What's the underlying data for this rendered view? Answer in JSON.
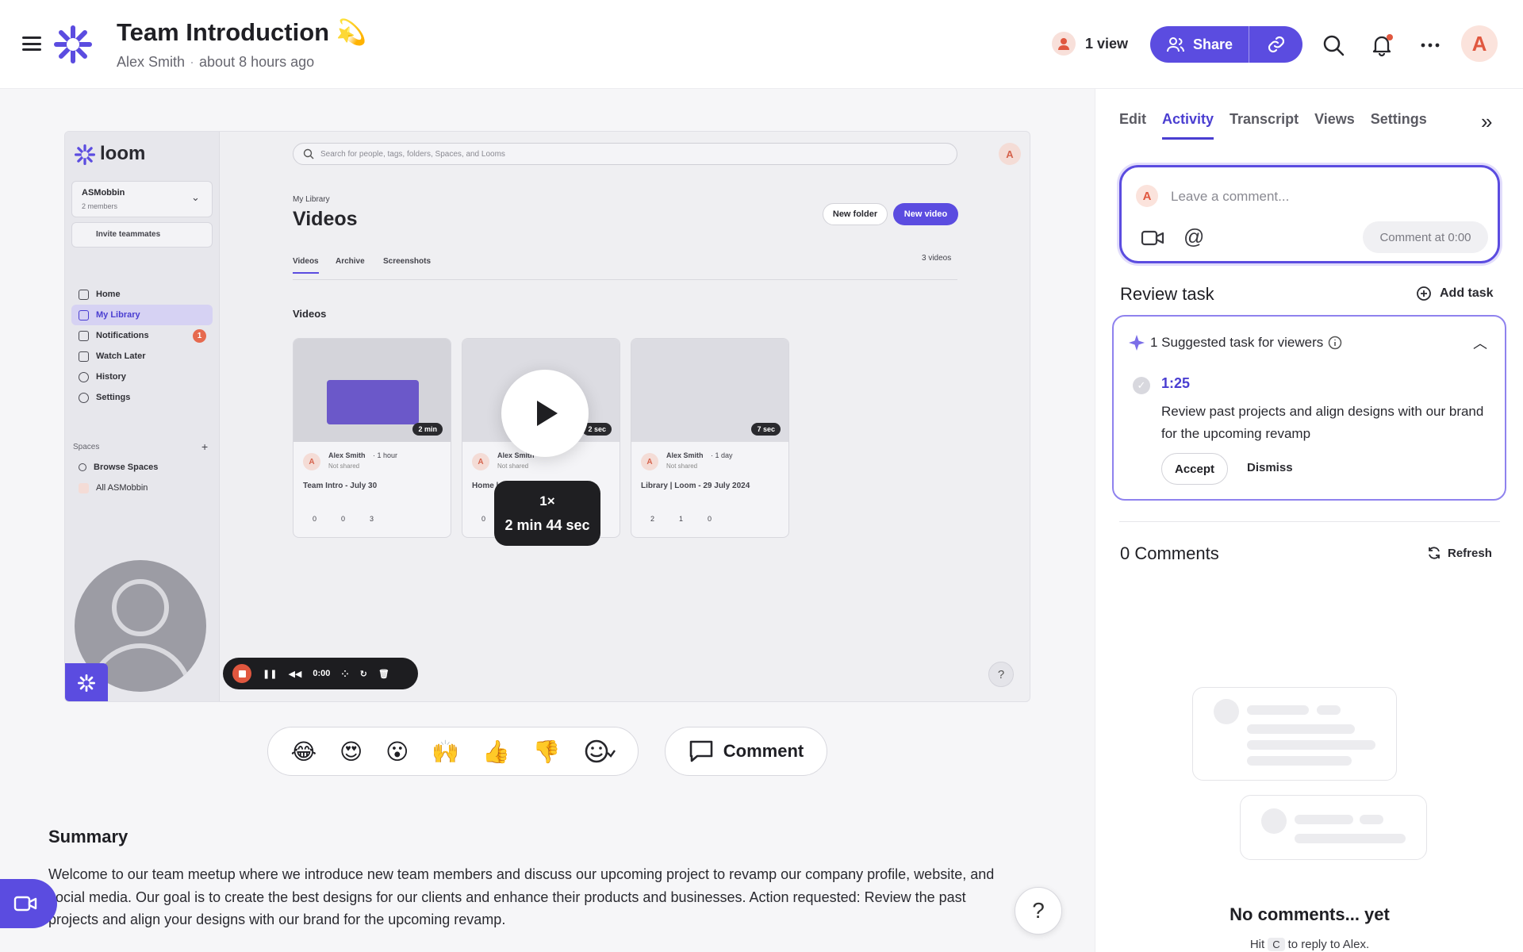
{
  "header": {
    "title": "Team Introduction 💫",
    "author": "Alex Smith",
    "time_ago": "about 8 hours ago",
    "views": "1 view",
    "share_label": "Share",
    "user_initial": "A"
  },
  "colors": {
    "accent": "#5b4ce0",
    "avatar_bg": "#fbe3dc",
    "avatar_fg": "#e0573f"
  },
  "video": {
    "sidebar": {
      "brand": "loom",
      "workspace": "ASMobbin",
      "workspace_members": "2 members",
      "invite": "Invite teammates",
      "nav": [
        {
          "label": "Home"
        },
        {
          "label": "My Library"
        },
        {
          "label": "Notifications",
          "badge": "1"
        },
        {
          "label": "Watch Later"
        },
        {
          "label": "History"
        },
        {
          "label": "Settings"
        }
      ],
      "spaces_label": "Spaces",
      "browse_spaces": "Browse Spaces",
      "all_spaces": "All ASMobbin"
    },
    "search_placeholder": "Search for people, tags, folders, Spaces, and Looms",
    "avatar_initial": "A",
    "breadcrumb": "My Library",
    "page_title": "Videos",
    "new_folder": "New folder",
    "new_video": "New video",
    "tabs": [
      "Videos",
      "Archive",
      "Screenshots"
    ],
    "count": "3 videos",
    "section": "Videos",
    "cards": [
      {
        "author": "Alex Smith",
        "time": "· 1 hour",
        "sharing": "Not shared",
        "title": "Team Intro - July 30",
        "duration": "2 min",
        "stats": [
          "0",
          "0",
          "3"
        ]
      },
      {
        "author": "Alex Smith",
        "time": "",
        "sharing": "Not shared",
        "title": "Home |",
        "duration": "2 sec",
        "stats": [
          "0"
        ]
      },
      {
        "author": "Alex Smith",
        "time": "· 1 day",
        "sharing": "Not shared",
        "title": "Library | Loom - 29 July 2024",
        "duration": "7 sec",
        "stats": [
          "2",
          "1",
          "0"
        ]
      }
    ],
    "speed": "1×",
    "length": "2 min 44 sec",
    "rec_time": "0:00",
    "help": "?"
  },
  "reactions": [
    "😂",
    "😍",
    "😮",
    "🙌",
    "👍",
    "👎"
  ],
  "comment_button": "Comment",
  "summary": {
    "heading": "Summary",
    "text": "Welcome to our team meetup where we introduce new team members and discuss our upcoming project to revamp our company profile, website, and social media. Our goal is to create the best designs for our clients and enhance their products and businesses. Action requested: Review the past projects and align your designs with our brand for the upcoming revamp."
  },
  "help_fab": "?",
  "panel": {
    "tabs": [
      "Edit",
      "Activity",
      "Transcript",
      "Views",
      "Settings"
    ],
    "active_tab": "Activity",
    "comment_placeholder": "Leave a comment...",
    "comment_at": "Comment at 0:00",
    "review_task": "Review task",
    "add_task": "Add task",
    "suggested": "1 Suggested task for viewers",
    "task_time": "1:25",
    "task_desc": "Review past projects and align designs with our brand for the upcoming revamp",
    "accept": "Accept",
    "dismiss": "Dismiss",
    "comments_count": "0 Comments",
    "refresh": "Refresh",
    "empty_title": "No comments... yet",
    "hint_pre": "Hit",
    "hint_key": "C",
    "hint_post": "to reply to Alex."
  }
}
